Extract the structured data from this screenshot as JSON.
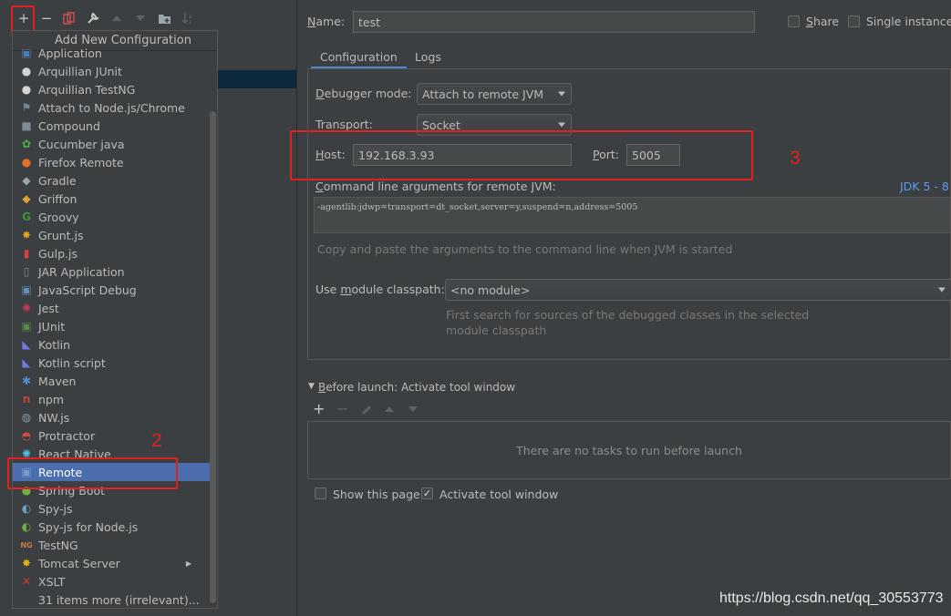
{
  "toolbar": {
    "add_icon": "+",
    "remove_icon": "−"
  },
  "popup": {
    "title": "Add New Configuration",
    "items": [
      {
        "label": "Application",
        "icon": "app-icon",
        "glyph": "▣",
        "color": "#4a7fb5"
      },
      {
        "label": "Arquillian JUnit",
        "icon": "arquillian-icon",
        "glyph": "●",
        "color": "#d4d4d4"
      },
      {
        "label": "Arquillian TestNG",
        "icon": "arquillian-icon",
        "glyph": "●",
        "color": "#d4d4d4"
      },
      {
        "label": "Attach to Node.js/Chrome",
        "icon": "nodejs-attach-icon",
        "glyph": "⚑",
        "color": "#6e8a9a"
      },
      {
        "label": "Compound",
        "icon": "folder-icon",
        "glyph": "■",
        "color": "#7e8b95"
      },
      {
        "label": "Cucumber java",
        "icon": "cucumber-icon",
        "glyph": "✿",
        "color": "#4caf50"
      },
      {
        "label": "Firefox Remote",
        "icon": "firefox-icon",
        "glyph": "●",
        "color": "#e76e24"
      },
      {
        "label": "Gradle",
        "icon": "gradle-icon",
        "glyph": "◆",
        "color": "#9aa5ad"
      },
      {
        "label": "Griffon",
        "icon": "griffon-icon",
        "glyph": "◆",
        "color": "#e0a030"
      },
      {
        "label": "Groovy",
        "icon": "groovy-icon",
        "glyph": "G",
        "color": "#3f8f3f"
      },
      {
        "label": "Grunt.js",
        "icon": "grunt-icon",
        "glyph": "✸",
        "color": "#e3a224"
      },
      {
        "label": "Gulp.js",
        "icon": "gulp-icon",
        "glyph": "▮",
        "color": "#d94040"
      },
      {
        "label": "JAR Application",
        "icon": "jar-icon",
        "glyph": "▯",
        "color": "#8a8a8a"
      },
      {
        "label": "JavaScript Debug",
        "icon": "js-debug-icon",
        "glyph": "▣",
        "color": "#5e8fb5"
      },
      {
        "label": "Jest",
        "icon": "jest-icon",
        "glyph": "✺",
        "color": "#c2395c"
      },
      {
        "label": "JUnit",
        "icon": "junit-icon",
        "glyph": "▣",
        "color": "#5b8a4c"
      },
      {
        "label": "Kotlin",
        "icon": "kotlin-icon",
        "glyph": "◣",
        "color": "#6d79dc"
      },
      {
        "label": "Kotlin script",
        "icon": "kotlin-script-icon",
        "glyph": "◣",
        "color": "#6d79dc"
      },
      {
        "label": "Maven",
        "icon": "maven-gear-icon",
        "glyph": "✱",
        "color": "#4d8fd6"
      },
      {
        "label": "npm",
        "icon": "npm-icon",
        "glyph": "n",
        "color": "#c4423a"
      },
      {
        "label": "NW.js",
        "icon": "nwjs-icon",
        "glyph": "◍",
        "color": "#8b9aa5"
      },
      {
        "label": "Protractor",
        "icon": "protractor-icon",
        "glyph": "◓",
        "color": "#d24a3a"
      },
      {
        "label": "React Native",
        "icon": "react-icon",
        "glyph": "✺",
        "color": "#4fc0e8"
      },
      {
        "label": "Remote",
        "icon": "remote-icon",
        "glyph": "▣",
        "color": "#7b9fc6",
        "selected": true
      },
      {
        "label": "Spring Boot",
        "icon": "spring-boot-icon",
        "glyph": "●",
        "color": "#6cb33f"
      },
      {
        "label": "Spy-js",
        "icon": "spyjs-icon",
        "glyph": "◐",
        "color": "#6e9fc7"
      },
      {
        "label": "Spy-js for Node.js",
        "icon": "spyjs-node-icon",
        "glyph": "◐",
        "color": "#6cb33f"
      },
      {
        "label": "TestNG",
        "icon": "testng-icon",
        "glyph": "NG",
        "color": "#c97a40"
      },
      {
        "label": "Tomcat Server",
        "icon": "tomcat-icon",
        "glyph": "✸",
        "color": "#e3b31a",
        "submenu": true
      },
      {
        "label": "XSLT",
        "icon": "xslt-icon",
        "glyph": "✕",
        "color": "#d23c3c"
      },
      {
        "label": "31 items more (irrelevant)...",
        "icon": "",
        "glyph": "",
        "color": ""
      }
    ]
  },
  "annotations": {
    "step2": "2",
    "step3": "3"
  },
  "form": {
    "name_label": "Name:",
    "name_value": "test",
    "share_label": "Share",
    "single_instance_label": "Single instance o",
    "tabs": [
      "Configuration",
      "Logs"
    ],
    "debugger_mode_label": "Debugger mode:",
    "debugger_mode_value": "Attach to remote JVM",
    "transport_label": "Transport:",
    "transport_value": "Socket",
    "host_label": "Host:",
    "host_value": "192.168.3.93",
    "port_label": "Port:",
    "port_value": "5005",
    "cmd_label": "Command line arguments for remote JVM:",
    "jdk_label": "JDK 5 - 8",
    "cmd_value": "-agentlib:jdwp=transport=dt_socket,server=y,suspend=n,address=5005",
    "cmd_hint": "Copy and paste the arguments to the command line when JVM is started",
    "module_label": "Use module classpath:",
    "module_value": "<no module>",
    "module_hint_1": "First search for sources of the debugged classes in the selected",
    "module_hint_2": "module classpath",
    "before_launch_label": "Before launch: Activate tool window",
    "no_tasks": "There are no tasks to run before launch",
    "show_page_label": "Show this page",
    "activate_tool_label": "Activate tool window",
    "activate_tool_checked": true,
    "show_page_checked": false
  },
  "watermark": "https://blog.csdn.net/qq_30553773"
}
